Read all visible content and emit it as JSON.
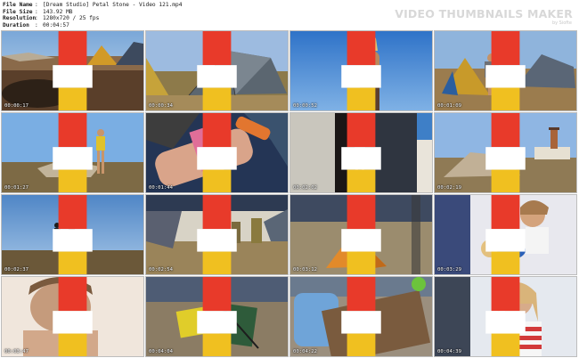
{
  "header": {
    "rows": [
      {
        "key": "File Name",
        "value": "[Dream Studio] Petal Stone - Video 121.mp4"
      },
      {
        "key": "File Size",
        "value": "143.92 MB"
      },
      {
        "key": "Resolution",
        "value": "1280x720 / 25 fps"
      },
      {
        "key": "Duration",
        "value": "00:04:57"
      }
    ],
    "separator": ":",
    "brand": "VIDEO THUMBNAILS MAKER",
    "brand_sub": "by Siofte"
  },
  "thumbnails": [
    {
      "timestamp": "00:00:17",
      "scene": "tent-rocks"
    },
    {
      "timestamp": "00:00:34",
      "scene": "tent-closeup"
    },
    {
      "timestamp": "00:00:52",
      "scene": "girl-sky"
    },
    {
      "timestamp": "00:01:09",
      "scene": "tent-girl"
    },
    {
      "timestamp": "00:01:27",
      "scene": "girl-field"
    },
    {
      "timestamp": "00:01:44",
      "scene": "sleeping-bag"
    },
    {
      "timestamp": "00:02:02",
      "scene": "doorway"
    },
    {
      "timestamp": "00:02:19",
      "scene": "lighthouse"
    },
    {
      "timestamp": "00:02:37",
      "scene": "silhouettes"
    },
    {
      "timestamp": "00:02:54",
      "scene": "shade-tent"
    },
    {
      "timestamp": "00:03:12",
      "scene": "orange-tent"
    },
    {
      "timestamp": "00:03:29",
      "scene": "eating"
    },
    {
      "timestamp": "00:03:47",
      "scene": "face-close"
    },
    {
      "timestamp": "00:04:04",
      "scene": "camp-gear"
    },
    {
      "timestamp": "00:04:22",
      "scene": "backpack"
    },
    {
      "timestamp": "00:04:39",
      "scene": "girl-stripes"
    }
  ]
}
